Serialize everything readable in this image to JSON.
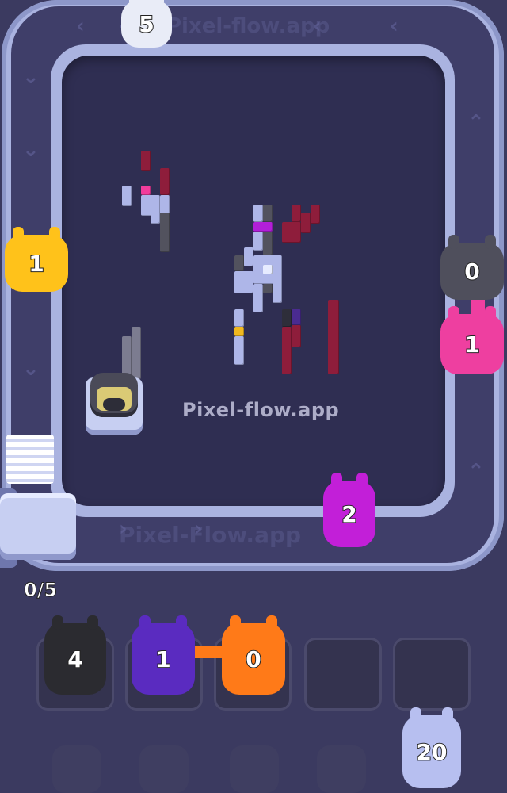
{
  "app": {
    "watermark": "Pixel-flow.app"
  },
  "track_labels": {
    "top": "Pixel-flow.app",
    "bottom": "Pixel-Flow.app"
  },
  "colors": {
    "board": "#2f2e52",
    "track": "#aab3e0",
    "yellow": "#ffc21a",
    "gray": "#4f4f5c",
    "pink": "#ee3fa0",
    "magenta": "#c21fd8",
    "black": "#2b2b30",
    "purple": "#5a2bc0",
    "orange": "#ff7a18",
    "lavender": "#b7bff0",
    "white": "#e9ecf7"
  },
  "track_pigs": [
    {
      "id": "pig-white-top",
      "count": "5",
      "color": "white"
    },
    {
      "id": "pig-yellow-left",
      "count": "1",
      "color": "yellow"
    },
    {
      "id": "pig-gray-right",
      "count": "0",
      "color": "gray"
    },
    {
      "id": "pig-pink-right",
      "count": "1",
      "color": "pink"
    },
    {
      "id": "pig-magenta-bottom",
      "count": "2",
      "color": "magenta"
    }
  ],
  "queue_counter": "0/5",
  "slots": [
    {
      "count": "4",
      "color": "black"
    },
    {
      "count": "1",
      "color": "purple"
    },
    {
      "count": "0",
      "color": "orange"
    },
    {
      "count": "",
      "color": ""
    },
    {
      "count": "",
      "color": ""
    }
  ],
  "next_pig": {
    "count": "20",
    "color": "lavender"
  }
}
